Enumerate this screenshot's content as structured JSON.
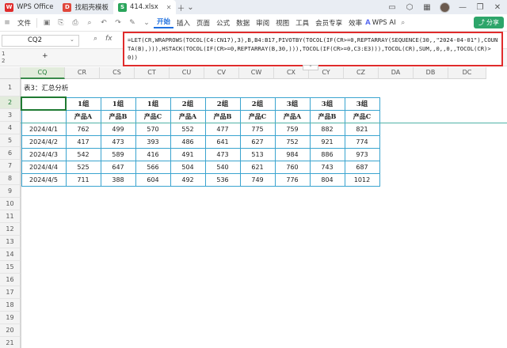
{
  "tabs": [
    {
      "label": "WPS Office",
      "icon": "wps-logo-icon",
      "color": "#e02b2b"
    },
    {
      "label": "找稻壳模板",
      "icon": "docer-icon",
      "color": "#e0473b"
    },
    {
      "label": "414.xlsx",
      "icon": "sheet-file-icon",
      "color": "#2aa55b"
    }
  ],
  "menu": {
    "file": "文件",
    "items": [
      "开始",
      "插入",
      "页面",
      "公式",
      "数据",
      "审阅",
      "视图",
      "工具",
      "会员专享",
      "效率"
    ],
    "active": "开始",
    "ai": "WPS AI",
    "share": "分享"
  },
  "formula_bar": {
    "name_box": "CQ2",
    "fx_label": "fx",
    "formula": "=LET(CR,WRAPROWS(TOCOL(C4:CN17),3),B,B4:B17,PIVOTBY(TOCOL(IF(CR>=0,REPTARRAY(SEQUENCE(30,,\"2024-04-01\"),COUNTA(B),))),HSTACK(TOCOL(IF(CR>=0,REPTARRAY(B,30,))),TOCOL(IF(CR>=0,C3:E3))),TOCOL(CR),SUM,,0,,0,,TOCOL(CR)>0))"
  },
  "outline_levels": [
    "1",
    "2"
  ],
  "columns": [
    "CQ",
    "CR",
    "CS",
    "CT",
    "CU",
    "CV",
    "CW",
    "CX",
    "CY",
    "CZ",
    "DA",
    "DB",
    "DC"
  ],
  "rows": [
    "1",
    "2",
    "3",
    "4",
    "5",
    "6",
    "7",
    "8",
    "9",
    "10",
    "11",
    "12",
    "13",
    "14",
    "15",
    "16",
    "17",
    "18",
    "19",
    "20",
    "21"
  ],
  "sheet_title": "表3：汇总分析",
  "table": {
    "group_row": [
      "",
      "1组",
      "1组",
      "1组",
      "2组",
      "2组",
      "2组",
      "3组",
      "3组",
      "3组"
    ],
    "product_row": [
      "",
      "产品A",
      "产品B",
      "产品C",
      "产品A",
      "产品B",
      "产品C",
      "产品A",
      "产品B",
      "产品C"
    ],
    "data": [
      [
        "2024/4/1",
        "762",
        "499",
        "570",
        "552",
        "477",
        "775",
        "759",
        "882",
        "821"
      ],
      [
        "2024/4/2",
        "417",
        "473",
        "393",
        "486",
        "641",
        "627",
        "752",
        "921",
        "774"
      ],
      [
        "2024/4/3",
        "542",
        "589",
        "416",
        "491",
        "473",
        "513",
        "984",
        "886",
        "973"
      ],
      [
        "2024/4/4",
        "525",
        "647",
        "566",
        "504",
        "540",
        "621",
        "760",
        "743",
        "687"
      ],
      [
        "2024/4/5",
        "711",
        "388",
        "604",
        "492",
        "536",
        "749",
        "776",
        "804",
        "1012"
      ]
    ]
  },
  "colors": {
    "highlight_border": "#e02b2b",
    "table_border": "#3aa4cf",
    "selected_cell": "#1f7a32",
    "accent": "#1f6fde"
  }
}
